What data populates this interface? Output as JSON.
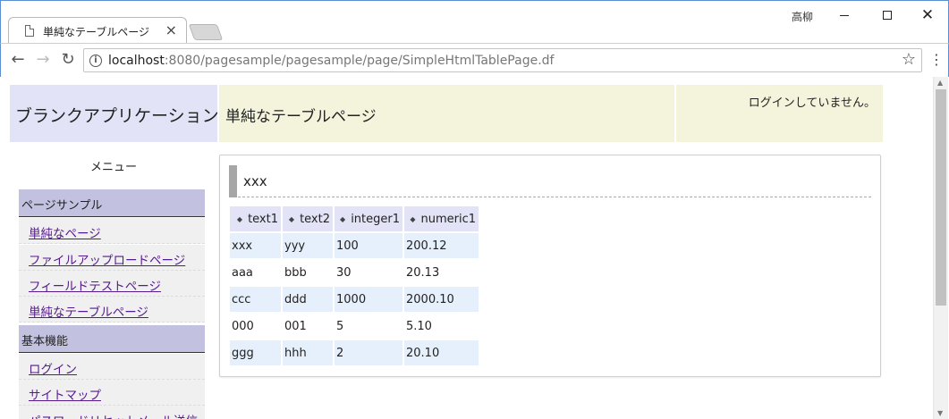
{
  "browser": {
    "tab_title": "単純なテーブルページ",
    "tab_close": "×",
    "user_name": "高柳",
    "url_host": "localhost",
    "url_rest": ":8080/pagesample/pagesample/page/SimpleHtmlTablePage.df"
  },
  "header": {
    "app_title": "ブランクアプリケーション",
    "page_title": "単純なテーブルページ",
    "login_status": "ログインしていません。"
  },
  "sidebar": {
    "title": "メニュー",
    "categories": [
      {
        "label": "ページサンプル"
      },
      {
        "label": "基本機能"
      }
    ],
    "items": [
      {
        "label": "単純なページ"
      },
      {
        "label": "ファイルアップロードページ"
      },
      {
        "label": "フィールドテストページ"
      },
      {
        "label": "単純なテーブルページ"
      },
      {
        "label": "ログイン"
      },
      {
        "label": "サイトマップ"
      },
      {
        "label": "パスワードリセットメール送信"
      }
    ]
  },
  "panel": {
    "title": "xxx",
    "columns": [
      "text1",
      "text2",
      "integer1",
      "numeric1"
    ],
    "rows": [
      [
        "xxx",
        "yyy",
        "100",
        "200.12"
      ],
      [
        "aaa",
        "bbb",
        "30",
        "20.13"
      ],
      [
        "ccc",
        "ddd",
        "1000",
        "2000.10"
      ],
      [
        "000",
        "001",
        "5",
        "5.10"
      ],
      [
        "ggg",
        "hhh",
        "2",
        "20.10"
      ]
    ]
  },
  "colors": {
    "app_header_bg": "#e3e3f7",
    "page_header_bg": "#f4f4dc",
    "menu_category_bg": "#c2c2e0",
    "row_shade": "#e6f0fc",
    "link": "#551a8b"
  }
}
